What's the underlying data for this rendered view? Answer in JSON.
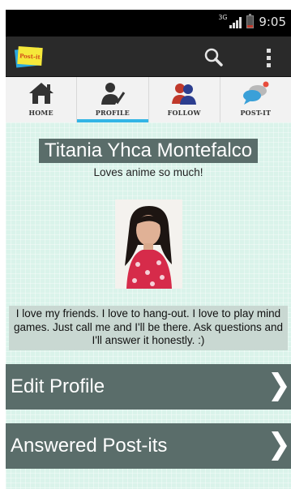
{
  "status_bar": {
    "network": "3G",
    "time": "9:05",
    "battery_level": 0.2
  },
  "action_bar": {
    "logo_text": "Post-it",
    "icons": [
      "app-logo-icon",
      "search-icon",
      "overflow-menu-icon"
    ]
  },
  "tabs": [
    {
      "label": "HOME",
      "icon": "home-icon",
      "active": false
    },
    {
      "label": "PROFILE",
      "icon": "profile-icon",
      "active": true
    },
    {
      "label": "FOLLOW",
      "icon": "follow-icon",
      "active": false
    },
    {
      "label": "POST-IT",
      "icon": "post-it-icon",
      "active": false
    }
  ],
  "profile": {
    "name": "Titania Yhca Montefalco",
    "tagline": "Loves anime so much!",
    "bio": "I love my friends. I love to hang-out. I love to play mind games. Just call me and I'll be there. Ask questions and I'll answer it honestly. :)"
  },
  "actions": {
    "edit_profile": "Edit Profile",
    "answered_postits": "Answered Post-its"
  },
  "colors": {
    "accent": "#33b5e5",
    "panel": "#5a6d6a",
    "background": "#daf3ea",
    "action_bar": "#2a2a2a"
  }
}
